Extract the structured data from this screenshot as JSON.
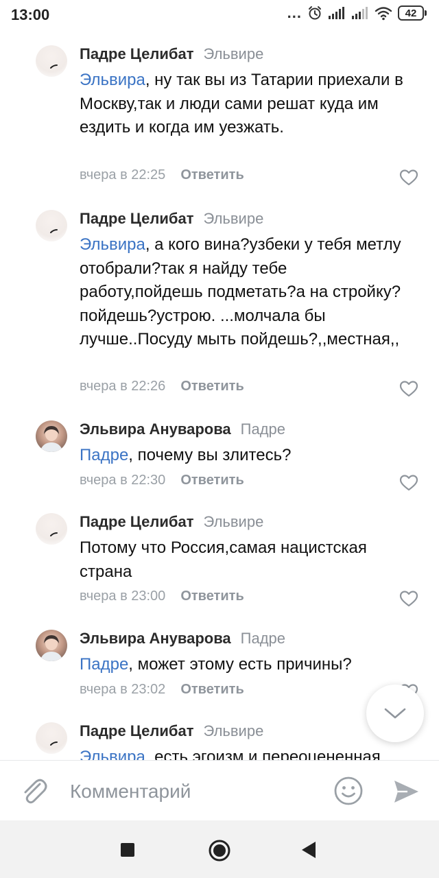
{
  "status_bar": {
    "time": "13:00",
    "dots": "...",
    "battery": "42",
    "icons": [
      "alarm-icon",
      "signal-icon",
      "signal-icon",
      "wifi-icon",
      "battery-icon"
    ]
  },
  "comments": [
    {
      "author": "Падре Целибат",
      "reply_to": "Эльвире",
      "avatar": "blank",
      "mention": "Эльвира",
      "text": ", ну так вы из Татарии приехали в Москву,так и люди сами решат куда им ездить и когда им уезжать.",
      "time": "вчера в 22:25",
      "reply_label": "Ответить"
    },
    {
      "author": "Падре Целибат",
      "reply_to": "Эльвире",
      "avatar": "blank",
      "mention": "Эльвира",
      "text": ", а кого вина?узбеки у тебя метлу отобрали?так я найду тебе работу,пойдешь подметать?а на стройку?пойдешь?устрою. ...молчала бы лучше..Посуду мыть пойдешь?,,местная,,",
      "time": "вчера в 22:26",
      "reply_label": "Ответить"
    },
    {
      "author": "Эльвира Ануварова",
      "reply_to": "Падре",
      "avatar": "photo",
      "mention": "Падре",
      "text": ", почему вы злитесь?",
      "time": "вчера в 22:30",
      "reply_label": "Ответить"
    },
    {
      "author": "Падре Целибат",
      "reply_to": "Эльвире",
      "avatar": "blank",
      "mention": "",
      "text": "Потому что Россия,самая нацистская страна",
      "time": "вчера в 23:00",
      "reply_label": "Ответить"
    },
    {
      "author": "Эльвира Ануварова",
      "reply_to": "Падре",
      "avatar": "photo",
      "mention": "Падре",
      "text": ", может этому есть причины?",
      "time": "вчера в 23:02",
      "reply_label": "Ответить"
    },
    {
      "author": "Падре Целибат",
      "reply_to": "Эльвире",
      "avatar": "blank",
      "mention": "Эльвира",
      "text": ", есть,эгоизм и переоцененная",
      "time": "",
      "reply_label": ""
    }
  ],
  "composer": {
    "placeholder": "Комментарий"
  },
  "colors": {
    "mention": "#3a73c4",
    "meta": "#9aa0a6",
    "author": "#2b2b2b",
    "navbar_bg": "#f2f2f2"
  }
}
